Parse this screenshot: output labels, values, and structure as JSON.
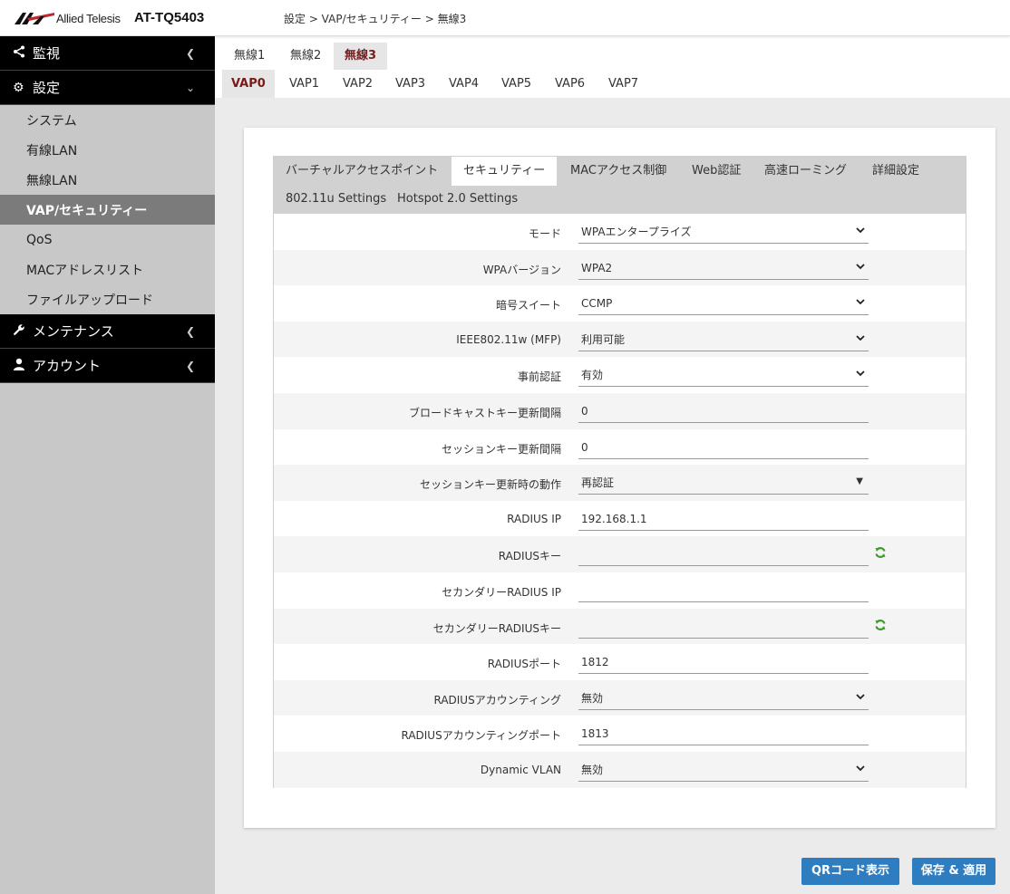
{
  "header": {
    "brand": "Allied Telesis",
    "model": "AT-TQ5403",
    "breadcrumb": "設定 > VAP/セキュリティー > 無線3"
  },
  "sidebar": {
    "items": [
      {
        "label": "監視",
        "icon": "share-icon"
      },
      {
        "label": "設定",
        "icon": "gear-icon"
      },
      {
        "label": "メンテナンス",
        "icon": "wrench-icon"
      },
      {
        "label": "アカウント",
        "icon": "user-icon"
      }
    ],
    "subitems": [
      "システム",
      "有線LAN",
      "無線LAN",
      "VAP/セキュリティー",
      "QoS",
      "MACアドレスリスト",
      "ファイルアップロード"
    ]
  },
  "radio_tabs": [
    "無線1",
    "無線2",
    "無線3"
  ],
  "vap_tabs": [
    "VAP0",
    "VAP1",
    "VAP2",
    "VAP3",
    "VAP4",
    "VAP5",
    "VAP6",
    "VAP7"
  ],
  "sub_tabs": [
    "バーチャルアクセスポイント",
    "セキュリティー",
    "MACアクセス制御",
    "Web認証",
    "高速ローミング",
    "詳細設定",
    "802.11u Settings",
    "Hotspot 2.0 Settings"
  ],
  "form": [
    {
      "label": "モード",
      "value": "WPAエンタープライズ"
    },
    {
      "label": "WPAバージョン",
      "value": "WPA2"
    },
    {
      "label": "暗号スイート",
      "value": "CCMP"
    },
    {
      "label": "IEEE802.11w (MFP)",
      "value": "利用可能"
    },
    {
      "label": "事前認証",
      "value": "有効"
    },
    {
      "label": "ブロードキャストキー更新間隔",
      "value": "0"
    },
    {
      "label": "セッションキー更新間隔",
      "value": "0"
    },
    {
      "label": "セッションキー更新時の動作",
      "value": "再認証"
    },
    {
      "label": "RADIUS IP",
      "value": "192.168.1.1"
    },
    {
      "label": "RADIUSキー",
      "value": ""
    },
    {
      "label": "セカンダリーRADIUS IP",
      "value": ""
    },
    {
      "label": "セカンダリーRADIUSキー",
      "value": ""
    },
    {
      "label": "RADIUSポート",
      "value": "1812"
    },
    {
      "label": "RADIUSアカウンティング",
      "value": "無効"
    },
    {
      "label": "RADIUSアカウンティングポート",
      "value": "1813"
    },
    {
      "label": "Dynamic VLAN",
      "value": "無効"
    }
  ],
  "buttons": {
    "qr": "QRコード表示",
    "save": "保存 & 適用"
  },
  "colors": {
    "accent": "#7a1b1b",
    "button": "#2f7dc1",
    "sidebar_active": "#7b7b7b",
    "regen_icon": "#3a9a2a"
  }
}
